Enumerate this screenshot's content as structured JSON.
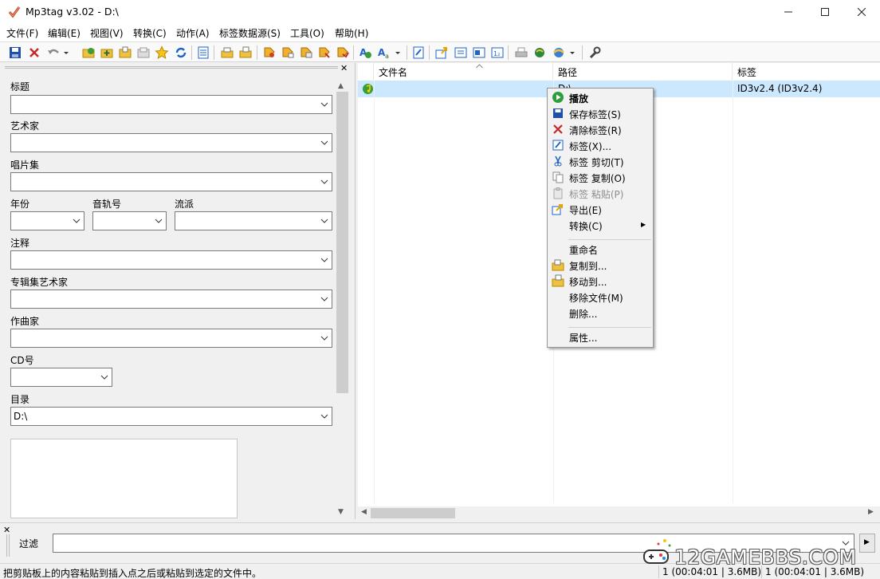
{
  "window": {
    "title": "Mp3tag v3.02  -  D:\\"
  },
  "menu": [
    "文件(F)",
    "编辑(E)",
    "视图(V)",
    "转换(C)",
    "动作(A)",
    "标签数据源(S)",
    "工具(O)",
    "帮助(H)"
  ],
  "toolbar_icons": [
    "save-icon",
    "remove-tag-icon",
    "undo-icon",
    "dropdown-arrow-icon",
    "add-folder-icon",
    "add-files-icon",
    "load-folder-icon",
    "folder-icon",
    "favorite-star-icon",
    "refresh-icon",
    "view-icon",
    "open-icon",
    "copy-folder-icon",
    "tag-filename-icon",
    "filename-tag-icon",
    "text-tag-icon",
    "tag-tag-icon",
    "actions-icon",
    "auto-number-icon",
    "case-convert-icon",
    "dropdown-arrow-icon",
    "edit-tag-icon",
    "export-icon",
    "playlist-icon",
    "playlist2-icon",
    "numbering-icon",
    "print-icon",
    "web-sources-icon",
    "globe-icon",
    "dropdown-arrow-icon",
    "settings-wrench-icon"
  ],
  "tag_panel": {
    "title_label": "标题",
    "title_value": "",
    "artist_label": "艺术家",
    "artist_value": "",
    "album_label": "唱片集",
    "album_value": "",
    "year_label": "年份",
    "year_value": "",
    "track_label": "音轨号",
    "track_value": "",
    "genre_label": "流派",
    "genre_value": "",
    "comment_label": "注释",
    "comment_value": "",
    "album_artist_label": "专辑集艺术家",
    "album_artist_value": "",
    "composer_label": "作曲家",
    "composer_value": "",
    "disc_label": "CD号",
    "disc_value": "",
    "directory_label": "目录",
    "directory_value": "D:\\"
  },
  "file_list": {
    "columns": [
      "文件名",
      "路径",
      "标签"
    ],
    "rows": [
      {
        "filename": "",
        "path": "D:\\",
        "tag": "ID3v2.4 (ID3v2.4)"
      }
    ]
  },
  "context_menu": {
    "items": [
      {
        "label": "播放",
        "icon": "play-icon",
        "bold": true
      },
      {
        "label": "保存标签(S)",
        "icon": "save-icon"
      },
      {
        "label": "清除标签(R)",
        "icon": "remove-tag-icon"
      },
      {
        "label": "标签(X)...",
        "icon": "edit-tag-icon"
      },
      {
        "label": "标签 剪切(T)",
        "icon": "cut-icon"
      },
      {
        "label": "标签 复制(O)",
        "icon": "copy-icon"
      },
      {
        "label": "标签 粘贴(P)",
        "icon": "paste-icon",
        "disabled": true
      },
      {
        "label": "导出(E)",
        "icon": "export-icon"
      },
      {
        "label": "转换(C)",
        "icon": "",
        "submenu": true
      },
      {
        "label": "重命名",
        "icon": ""
      },
      {
        "label": "复制到...",
        "icon": "copy-to-folder-icon"
      },
      {
        "label": "移动到...",
        "icon": "move-to-folder-icon"
      },
      {
        "label": "移除文件(M)",
        "icon": ""
      },
      {
        "label": "删除...",
        "icon": ""
      },
      {
        "label": "属性...",
        "icon": ""
      }
    ]
  },
  "filter": {
    "label": "过滤",
    "value": ""
  },
  "status": {
    "text": "把剪贴板上的内容粘贴到插入点之后或粘贴到选定的文件中。",
    "selected": "1 (00:04:01 | 3.6MB)",
    "total": "1 (00:04:01 | 3.6MB)"
  },
  "watermark": "12GAMEBBS.COM",
  "colors": {
    "selection": "#cce8ff",
    "accent": "#0078d7"
  }
}
